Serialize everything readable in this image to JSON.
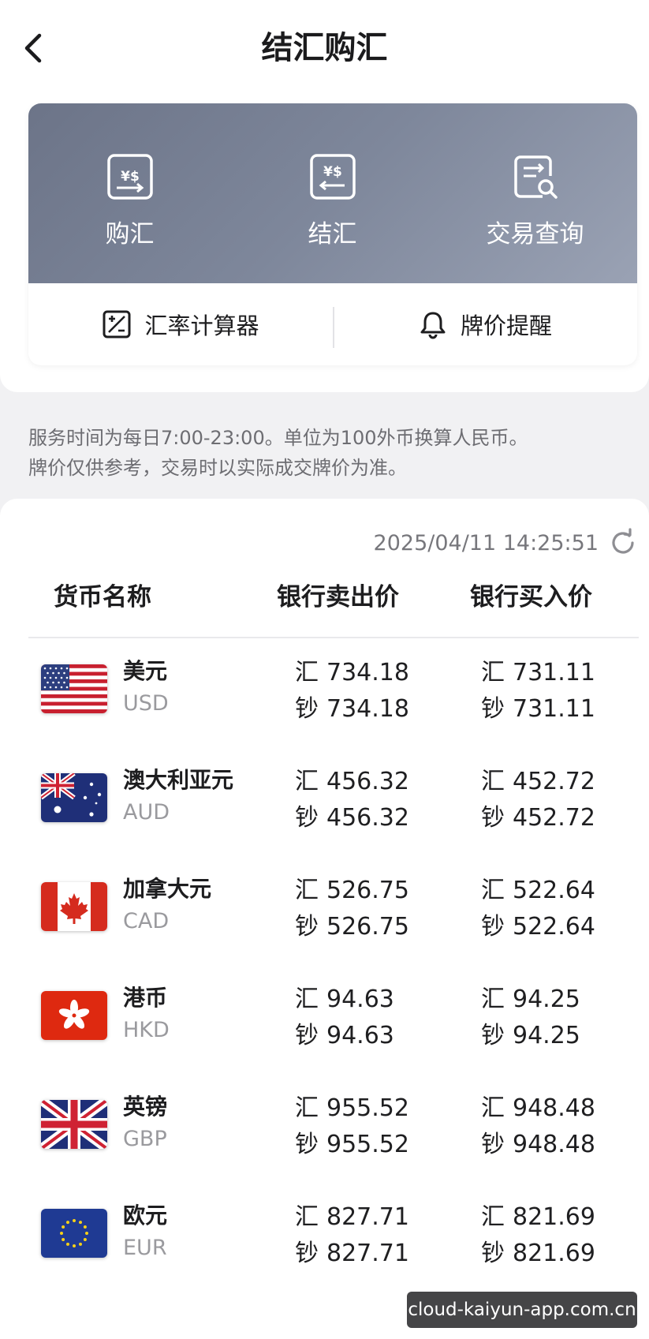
{
  "header": {
    "title": "结汇购汇"
  },
  "actions": [
    {
      "label": "购汇",
      "icon": "buy-fx-icon"
    },
    {
      "label": "结汇",
      "icon": "sell-fx-icon"
    },
    {
      "label": "交易查询",
      "icon": "transaction-query-icon"
    }
  ],
  "tools": [
    {
      "label": "汇率计算器",
      "icon": "calculator-icon"
    },
    {
      "label": "牌价提醒",
      "icon": "bell-icon"
    }
  ],
  "notice": {
    "line1": "服务时间为每日7:00-23:00。单位为100外币换算人民币。",
    "line2": "牌价仅供参考，交易时以实际成交牌价为准。"
  },
  "rates": {
    "timestamp": "2025/04/11 14:25:51",
    "headers": {
      "currency": "货币名称",
      "sell": "银行卖出价",
      "buy": "银行买入价"
    },
    "remit_tag": "汇",
    "cash_tag": "钞",
    "rows": [
      {
        "name": "美元",
        "code": "USD",
        "sell_remit": "734.18",
        "sell_cash": "734.18",
        "buy_remit": "731.11",
        "buy_cash": "731.11"
      },
      {
        "name": "澳大利亚元",
        "code": "AUD",
        "sell_remit": "456.32",
        "sell_cash": "456.32",
        "buy_remit": "452.72",
        "buy_cash": "452.72"
      },
      {
        "name": "加拿大元",
        "code": "CAD",
        "sell_remit": "526.75",
        "sell_cash": "526.75",
        "buy_remit": "522.64",
        "buy_cash": "522.64"
      },
      {
        "name": "港币",
        "code": "HKD",
        "sell_remit": "94.63",
        "sell_cash": "94.63",
        "buy_remit": "94.25",
        "buy_cash": "94.25"
      },
      {
        "name": "英镑",
        "code": "GBP",
        "sell_remit": "955.52",
        "sell_cash": "955.52",
        "buy_remit": "948.48",
        "buy_cash": "948.48"
      },
      {
        "name": "欧元",
        "code": "EUR",
        "sell_remit": "827.71",
        "sell_cash": "827.71",
        "buy_remit": "821.69",
        "buy_cash": "821.69"
      }
    ]
  },
  "watermark": "cloud-kaiyun-app.com.cn",
  "colors": {
    "card_gradient_start": "#6c7488",
    "card_gradient_end": "#9aa2b4",
    "text_secondary": "#9a9a9e"
  }
}
